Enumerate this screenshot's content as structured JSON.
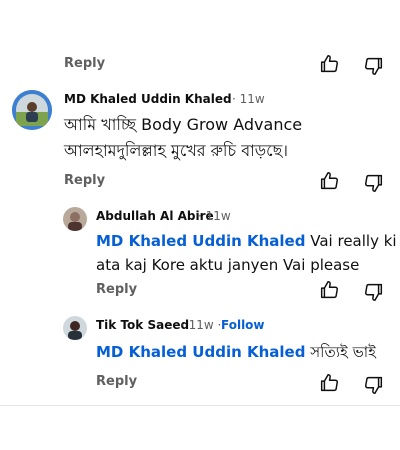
{
  "reply_label": "Reply",
  "colors": {
    "mention": "#065fd4",
    "meta": "#606060"
  },
  "icons": {
    "like": "thumbs-up-icon",
    "dislike": "thumbs-down-icon"
  },
  "comments": [
    {
      "author": "MD Khaled Uddin Khaled",
      "time": "· 11w",
      "text_line1": "আমি খাচ্ছি Body Grow Advance",
      "text_line2": "আলহামদুলিল্লাহ মুখের রুচি বাড়ছে।"
    },
    {
      "author": "Abdullah Al Abire",
      "time": "· 11w",
      "mention": "MD Khaled Uddin Khaled",
      "text_line1": " Vai really ki",
      "text_line2": "ata kaj Kore aktu janyen Vai please"
    },
    {
      "author": "Tik Tok Saeed",
      "time": "· 11w ·",
      "follow": "Follow",
      "mention": "MD Khaled Uddin Khaled",
      "text_line1": " সত্যিই ভাই"
    }
  ]
}
